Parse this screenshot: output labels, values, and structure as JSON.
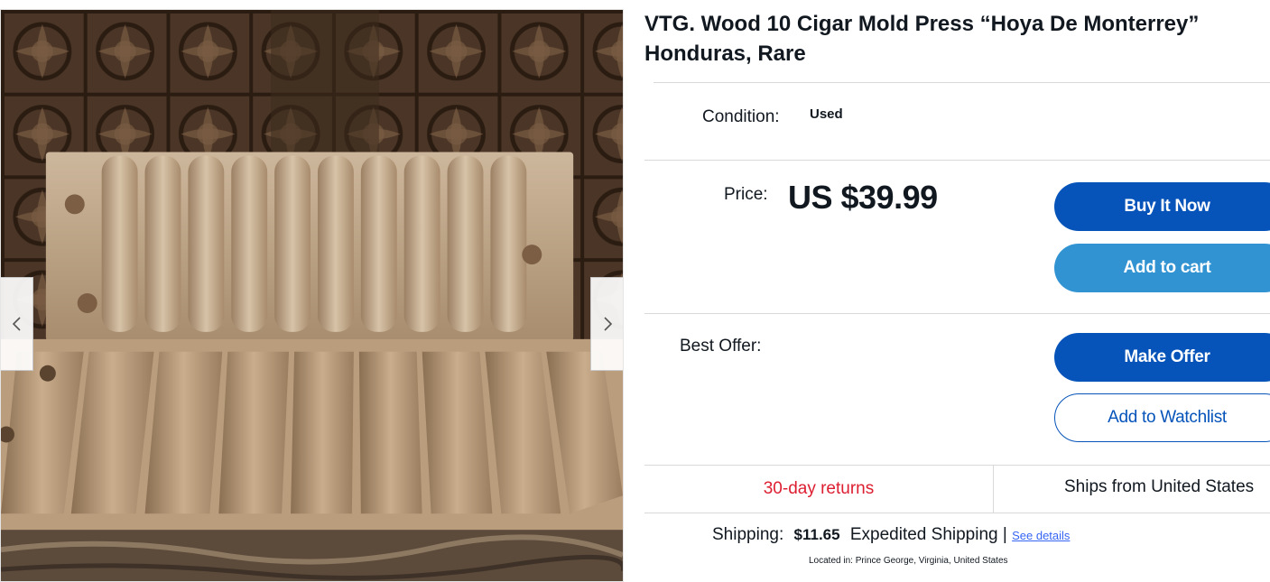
{
  "listing": {
    "title": "VTG. Wood 10 Cigar Mold Press “Hoya De Monterrey” Honduras, Rare",
    "condition_label": "Condition:",
    "condition_value": "Used",
    "price_label": "Price:",
    "price_value": "US $39.99",
    "best_offer_label": "Best Offer:",
    "returns": "30-day returns",
    "ships_from": "Ships from United States",
    "shipping_label": "Shipping:",
    "shipping_amount": "$11.65",
    "shipping_method": "Expedited Shipping |",
    "shipping_link": "See details",
    "located_label": "Located in:",
    "located_value": "Prince George, Virginia, United States"
  },
  "buttons": {
    "buy_now": "Buy It Now",
    "add_to_cart": "Add to cart",
    "make_offer": "Make Offer",
    "watchlist": "Add to Watchlist"
  },
  "gallery": {
    "prev_icon": "chevron-left-icon",
    "next_icon": "chevron-right-icon"
  },
  "colors": {
    "primary_button": "#0654ba",
    "secondary_button": "#3193d2",
    "returns_text": "#dd1e31",
    "link": "#3665f3"
  }
}
